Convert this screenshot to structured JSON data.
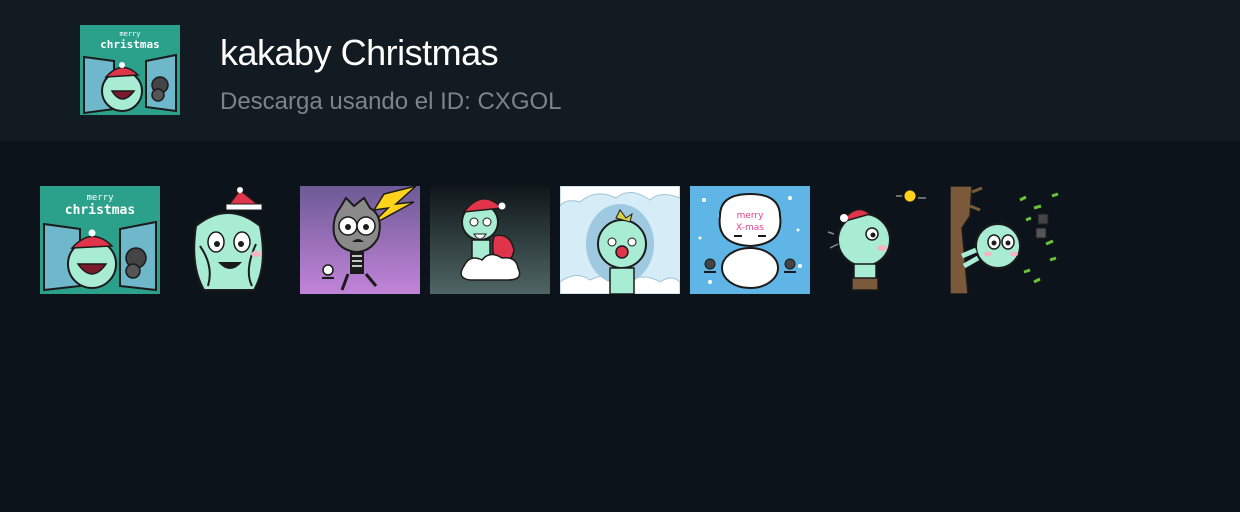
{
  "pack": {
    "title": "kakaby Christmas",
    "download_prefix": "Descarga usando el ID:",
    "download_id": "CXGOL",
    "subtitle": "Descarga usando el ID: CXGOL",
    "thumbnail_text": [
      "merry",
      "christmas"
    ]
  },
  "colors": {
    "header_bg": "#121a22",
    "page_bg": "#0c131b",
    "teal_sticker_bg": "#2ba08a",
    "character_mint": "#a8ecd4",
    "santa_red": "#e0344a"
  },
  "stickers": [
    {
      "icon": "merry-christmas-window-sticker",
      "text": [
        "merry",
        "christmas"
      ]
    },
    {
      "icon": "santa-hat-tangled-character-sticker",
      "text": []
    },
    {
      "icon": "lightning-skeleton-sticker",
      "text": []
    },
    {
      "icon": "santa-on-cloud-sticker",
      "text": []
    },
    {
      "icon": "snow-hole-red-nose-sticker",
      "text": []
    },
    {
      "icon": "snowman-merry-xmas-sticker",
      "text": [
        "merry",
        "X-mas"
      ]
    },
    {
      "icon": "santa-hat-moon-sticker",
      "text": []
    },
    {
      "icon": "windy-tree-character-sticker",
      "text": []
    }
  ]
}
